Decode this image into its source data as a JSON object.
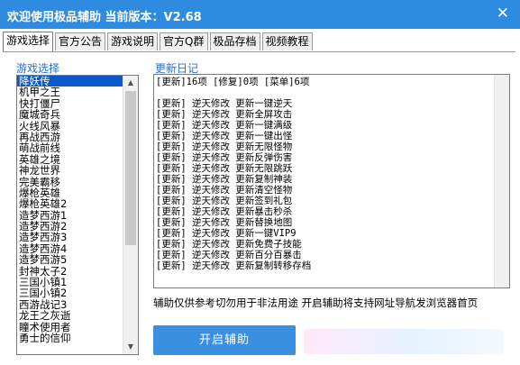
{
  "window": {
    "title": "欢迎使用极品辅助  当前版本：V2.68",
    "close_glyph": "✕"
  },
  "tabs": [
    {
      "label": "游戏选择",
      "active": true
    },
    {
      "label": "官方公告",
      "active": false
    },
    {
      "label": "游戏说明",
      "active": false
    },
    {
      "label": "官方Q群",
      "active": false
    },
    {
      "label": "极品存档",
      "active": false
    },
    {
      "label": "视频教程",
      "active": false
    }
  ],
  "game_list": {
    "label": "游戏选择",
    "selected_index": 0,
    "items": [
      "降妖传",
      "机甲之王",
      "快打僵尸",
      "魔城奇兵",
      "火线风暴",
      "再战西游",
      "萌战前线",
      "英雄之境",
      "神龙世界",
      "完美霸移",
      "爆枪英雄",
      "爆枪英雄2",
      "造梦西游1",
      "造梦西游2",
      "造梦西游3",
      "造梦西游4",
      "造梦西游5",
      "封神太子2",
      "三国小镇1",
      "三国小镇2",
      "西游战记3",
      "龙王之灰逝",
      "瞳术使用者",
      "勇士的信仰"
    ],
    "scrollbar": {
      "up_glyph": "▲",
      "down_glyph": "▼",
      "position_fraction": 0.0,
      "visible_fraction": 0.62
    }
  },
  "update_log": {
    "label": "更新日记",
    "summary": "[更新]16项 [修复]0项 [菜单]6项",
    "entries": [
      "[更新] 逆天修改 更新一键逆天",
      "[更新] 逆天修改 更新全屏攻击",
      "[更新] 逆天修改 更新一键满级",
      "[更新] 逆天修改 更新一键出怪",
      "[更新] 逆天修改 更新无限怪物",
      "[更新] 逆天修改 更新反弹伤害",
      "[更新] 逆天修改 更新无限跳跃",
      "[更新] 逆天修改 更新复制神装",
      "[更新] 逆天修改 更新清空怪物",
      "[更新] 逆天修改 更新签到礼包",
      "[更新] 逆天修改 更新暴击秒杀",
      "[更新] 逆天修改 更新替换地图",
      "[更新] 逆天修改 更新一键VIP9",
      "[更新] 逆天修改 更新免费子技能",
      "[更新] 逆天修改 更新百分百暴击",
      "[更新] 逆天修改 更新复制转移存档"
    ]
  },
  "notice": {
    "text": "辅助仅供参考切勿用于非法用途  开启辅助将支持网址导航发浏览器首页"
  },
  "start_button": {
    "label": "开启辅助"
  }
}
